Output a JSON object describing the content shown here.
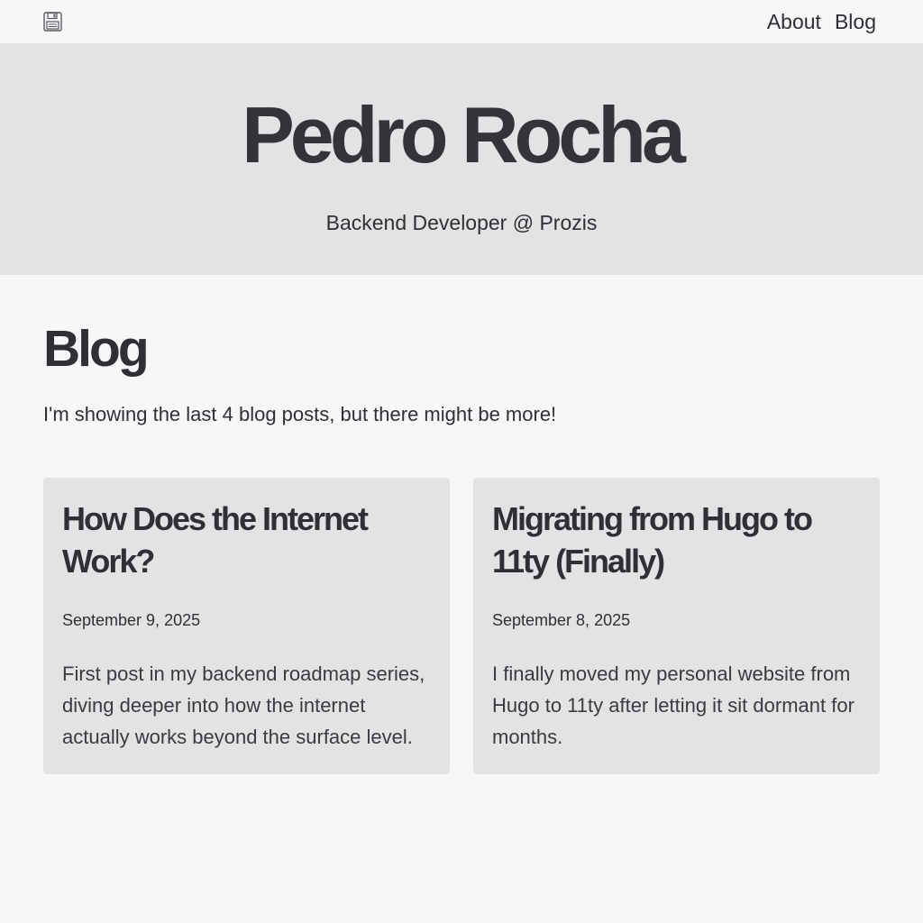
{
  "header": {
    "logo_icon": "floppy-disk-icon",
    "nav": [
      {
        "label": "About"
      },
      {
        "label": "Blog"
      }
    ]
  },
  "hero": {
    "title": "Pedro Rocha",
    "subtitle": "Backend Developer @ Prozis"
  },
  "main": {
    "heading": "Blog",
    "intro": "I'm showing the last 4 blog posts, but there might be more!",
    "posts": [
      {
        "title": "How Does the Internet Work?",
        "date": "September 9, 2025",
        "excerpt": "First post in my backend roadmap series, diving deeper into how the internet actually works beyond the surface level."
      },
      {
        "title": "Migrating from Hugo to 11ty (Finally)",
        "date": "September 8, 2025",
        "excerpt": "I finally moved my personal website from Hugo to 11ty after letting it sit dormant for months."
      }
    ]
  },
  "colors": {
    "page_background": "#f6f7f9",
    "hero_background": "#e3e3e5",
    "card_background": "#e3e3e5",
    "text": "#2f3033"
  }
}
